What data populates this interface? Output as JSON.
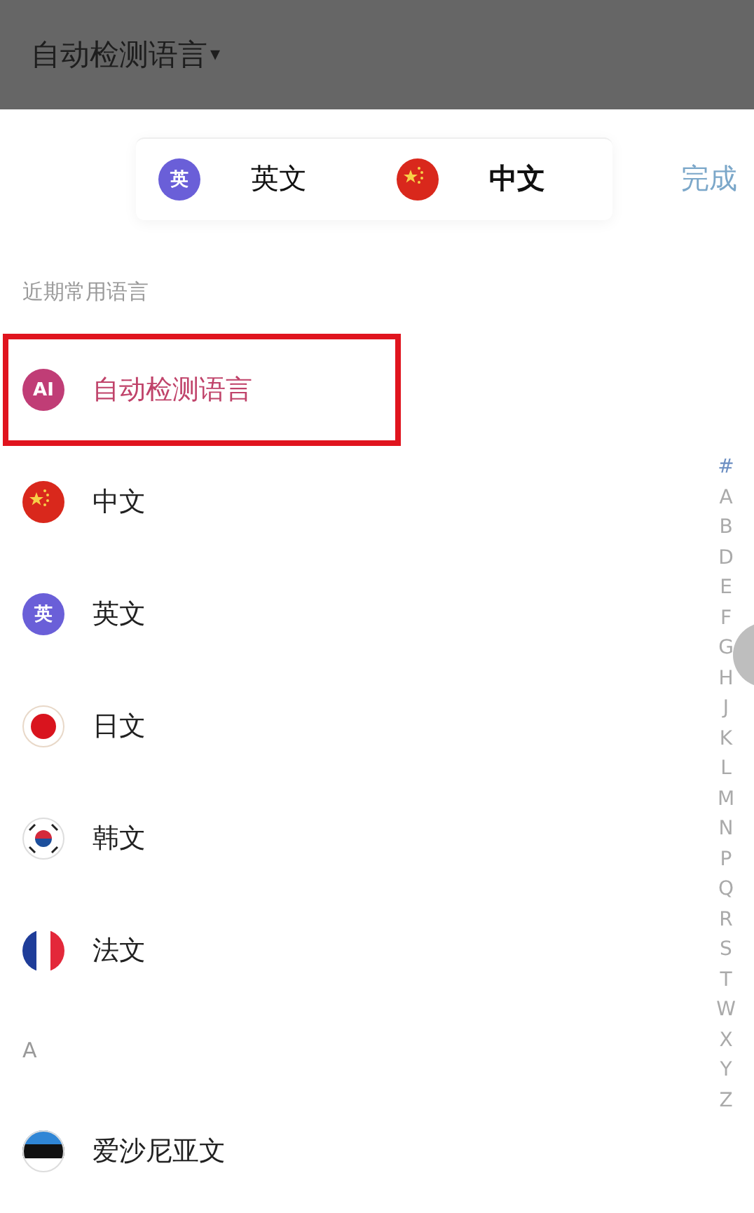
{
  "header": {
    "title": "自动检测语言",
    "caret": "▾"
  },
  "language_pair": {
    "source": {
      "label": "英文",
      "badge": "英",
      "kind": "text-badge"
    },
    "target": {
      "label": "中文",
      "kind": "cn"
    },
    "done": "完成"
  },
  "sections": [
    {
      "title": "近期常用语言",
      "items": [
        {
          "label": "自动检测语言",
          "kind": "ai-badge",
          "badge": "AI",
          "selected": true,
          "marked": true
        },
        {
          "label": "中文",
          "kind": "cn",
          "selected": false,
          "marked": false
        },
        {
          "label": "英文",
          "kind": "text-badge",
          "badge": "英",
          "selected": false,
          "marked": false
        },
        {
          "label": "日文",
          "kind": "jp",
          "selected": false,
          "marked": false
        },
        {
          "label": "韩文",
          "kind": "kr",
          "selected": false,
          "marked": false
        },
        {
          "label": "法文",
          "kind": "fr",
          "selected": false,
          "marked": false
        }
      ]
    },
    {
      "title": "A",
      "items": [
        {
          "label": "爱沙尼亚文",
          "kind": "ee",
          "selected": false,
          "marked": false
        }
      ]
    }
  ],
  "index": [
    "#",
    "A",
    "B",
    "D",
    "E",
    "F",
    "G",
    "H",
    "J",
    "K",
    "L",
    "M",
    "N",
    "P",
    "Q",
    "R",
    "S",
    "T",
    "W",
    "X",
    "Y",
    "Z"
  ]
}
